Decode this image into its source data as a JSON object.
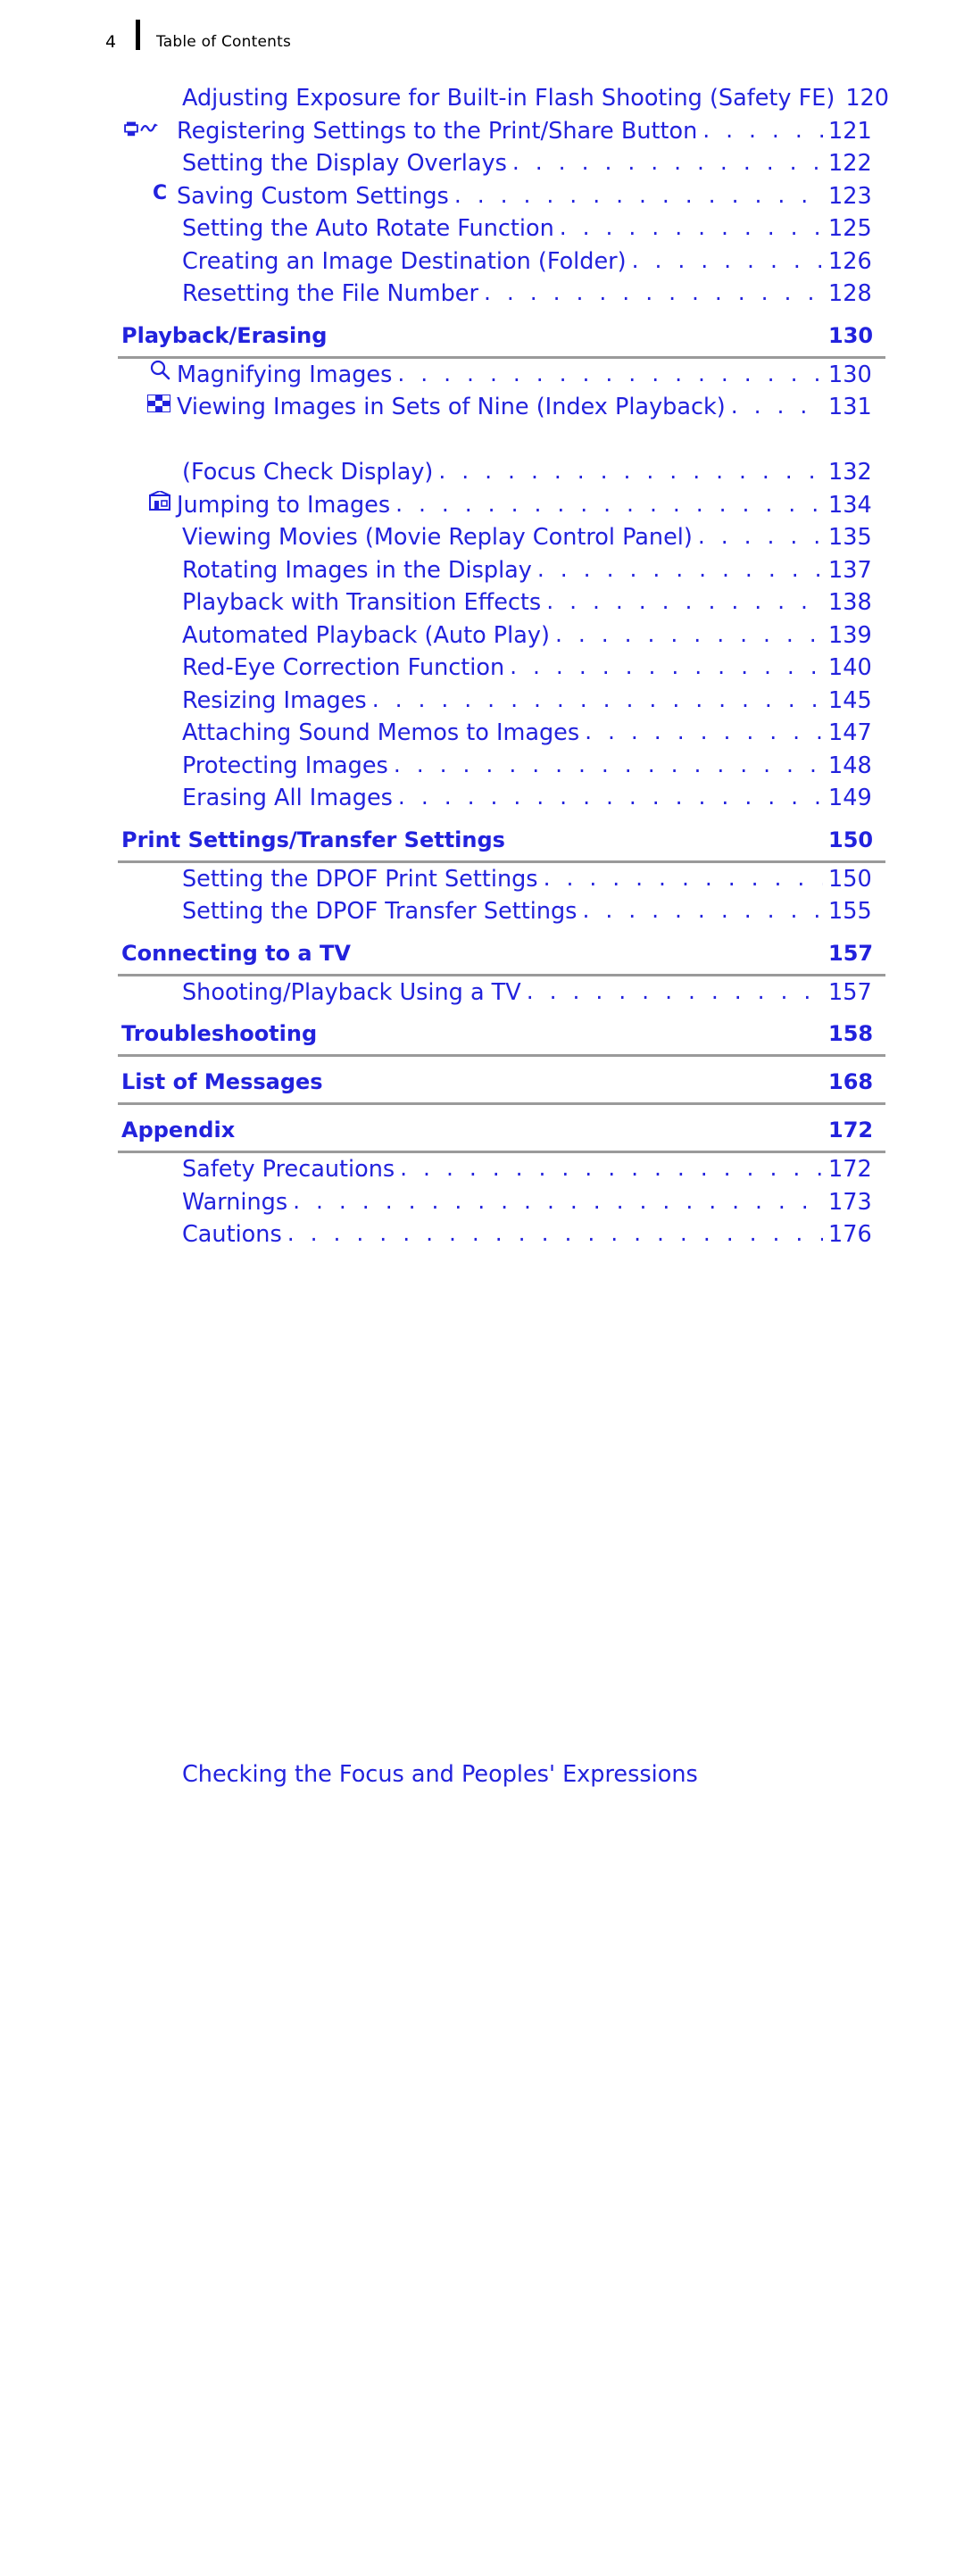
{
  "header": {
    "page_number": "4",
    "title": "Table of Contents"
  },
  "toc": {
    "entries": [
      {
        "icon": "",
        "label": "Adjusting Exposure for Built-in Flash Shooting (Safety FE)",
        "page": "120",
        "indent": true,
        "leader": true
      },
      {
        "icon": "print-share-icon",
        "label": "Registering Settings to the Print/Share Button",
        "page": "121",
        "indent": true,
        "leader": true
      },
      {
        "icon": "",
        "label": "Setting the Display Overlays",
        "page": "122",
        "indent": true,
        "leader": true
      },
      {
        "icon": "custom-settings-icon",
        "label": "Saving Custom Settings",
        "page": "123",
        "indent": true,
        "leader": true
      },
      {
        "icon": "",
        "label": "Setting the Auto Rotate Function",
        "page": "125",
        "indent": true,
        "leader": true
      },
      {
        "icon": "",
        "label": "Creating an Image Destination (Folder)",
        "page": "126",
        "indent": true,
        "leader": true
      },
      {
        "icon": "",
        "label": "Resetting the File Number",
        "page": "128",
        "indent": true,
        "leader": true
      }
    ],
    "sections": [
      {
        "label": "Playback/Erasing",
        "page": "130",
        "entries": [
          {
            "icon": "magnify-icon",
            "label": "Magnifying Images",
            "page": "130",
            "indent": true,
            "leader": true
          },
          {
            "icon": "index-playback-icon",
            "label": "Viewing Images in Sets of Nine (Index Playback)",
            "page": "131",
            "indent": true,
            "leader": true
          },
          {
            "icon": "",
            "label": "Checking the Focus and Peoples' Expressions",
            "page": "",
            "indent": true,
            "leader": false
          },
          {
            "icon": "",
            "label": "(Focus Check Display)",
            "page": "132",
            "indent": true,
            "leader": true
          },
          {
            "icon": "jump-icon",
            "label": "Jumping to Images",
            "page": "134",
            "indent": true,
            "leader": true
          },
          {
            "icon": "",
            "label": "Viewing Movies (Movie Replay Control Panel)",
            "page": "135",
            "indent": true,
            "leader": true
          },
          {
            "icon": "",
            "label": "Rotating Images in the Display",
            "page": "137",
            "indent": true,
            "leader": true
          },
          {
            "icon": "",
            "label": "Playback with Transition Effects",
            "page": "138",
            "indent": true,
            "leader": true
          },
          {
            "icon": "",
            "label": "Automated Playback (Auto Play)",
            "page": "139",
            "indent": true,
            "leader": true
          },
          {
            "icon": "",
            "label": "Red-Eye Correction Function",
            "page": "140",
            "indent": true,
            "leader": true
          },
          {
            "icon": "",
            "label": "Resizing Images",
            "page": "145",
            "indent": true,
            "leader": true
          },
          {
            "icon": "",
            "label": "Attaching Sound Memos to Images",
            "page": "147",
            "indent": true,
            "leader": true
          },
          {
            "icon": "",
            "label": "Protecting Images",
            "page": "148",
            "indent": true,
            "leader": true
          },
          {
            "icon": "",
            "label": "Erasing All Images",
            "page": "149",
            "indent": true,
            "leader": true
          }
        ]
      },
      {
        "label": "Print Settings/Transfer Settings",
        "page": "150",
        "entries": [
          {
            "icon": "",
            "label": "Setting the DPOF Print Settings",
            "page": "150",
            "indent": true,
            "leader": true
          },
          {
            "icon": "",
            "label": "Setting the DPOF Transfer Settings",
            "page": "155",
            "indent": true,
            "leader": true
          }
        ]
      },
      {
        "label": "Connecting to a TV",
        "page": "157",
        "entries": [
          {
            "icon": "",
            "label": "Shooting/Playback Using a TV",
            "page": "157",
            "indent": true,
            "leader": true
          }
        ]
      },
      {
        "label": "Troubleshooting",
        "page": "158",
        "entries": []
      },
      {
        "label": "List of Messages",
        "page": "168",
        "entries": []
      },
      {
        "label": "Appendix",
        "page": "172",
        "entries": [
          {
            "icon": "",
            "label": "Safety Precautions",
            "page": "172",
            "indent": true,
            "leader": true
          },
          {
            "icon": "",
            "label": "Warnings",
            "page": "173",
            "indent": true,
            "leader": true
          },
          {
            "icon": "",
            "label": "Cautions",
            "page": "176",
            "indent": true,
            "leader": true
          }
        ]
      }
    ]
  },
  "colors": {
    "link": "#2222dd",
    "rule": "#9a9a9a",
    "text": "#000000"
  }
}
